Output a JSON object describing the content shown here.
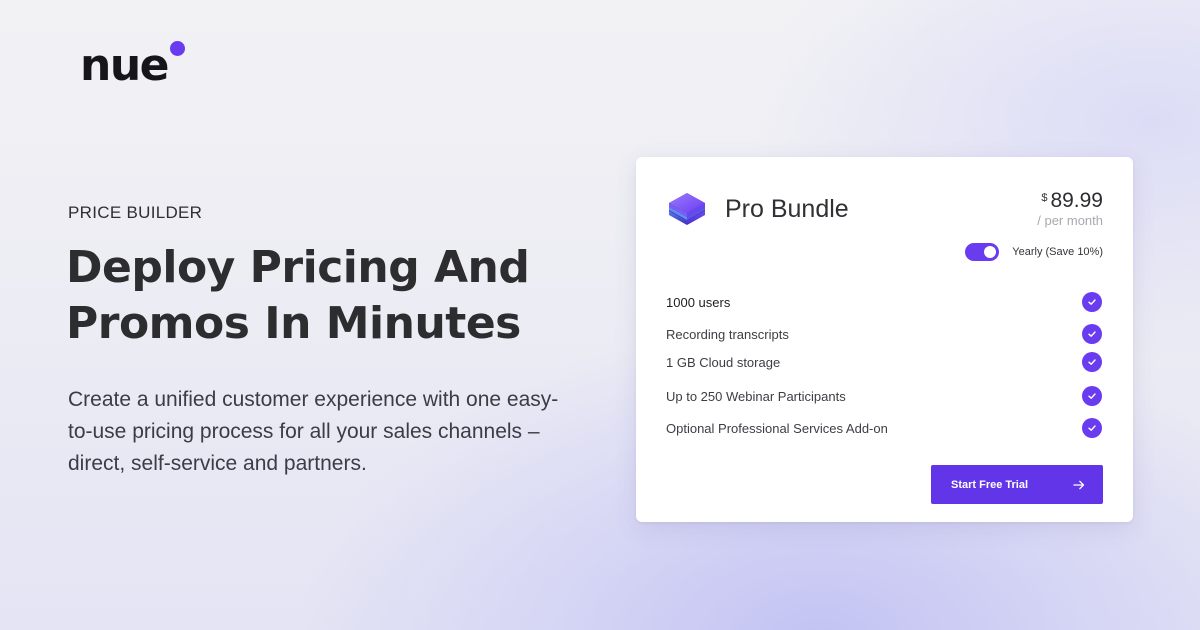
{
  "brand": {
    "logo_text": "nue",
    "accent_color": "#6a3cf0"
  },
  "hero": {
    "eyebrow": "PRICE BUILDER",
    "headline_line1": "Deploy Pricing And",
    "headline_line2": "Promos In Minutes",
    "description": "Create a unified customer experience with one easy-to-use pricing process for all your sales channels – direct, self-service and partners."
  },
  "pricing_card": {
    "plan_icon": "layered-cube-icon",
    "plan_name": "Pro Bundle",
    "currency": "$",
    "price": "89.99",
    "period": "/ per month",
    "billing_toggle": {
      "label": "Yearly (Save 10%)",
      "on": true
    },
    "features": [
      {
        "label": "1000 users",
        "icon": "check-circle-icon"
      },
      {
        "label": "Recording transcripts",
        "icon": "check-circle-icon"
      },
      {
        "label": "1 GB Cloud storage",
        "icon": "check-circle-icon"
      },
      {
        "label": "Up to 250 Webinar Participants",
        "icon": "check-circle-icon"
      },
      {
        "label": "Optional Professional Services Add-on",
        "icon": "check-circle-icon"
      }
    ],
    "cta_label": "Start Free Trial",
    "cta_icon": "arrow-right-icon"
  }
}
